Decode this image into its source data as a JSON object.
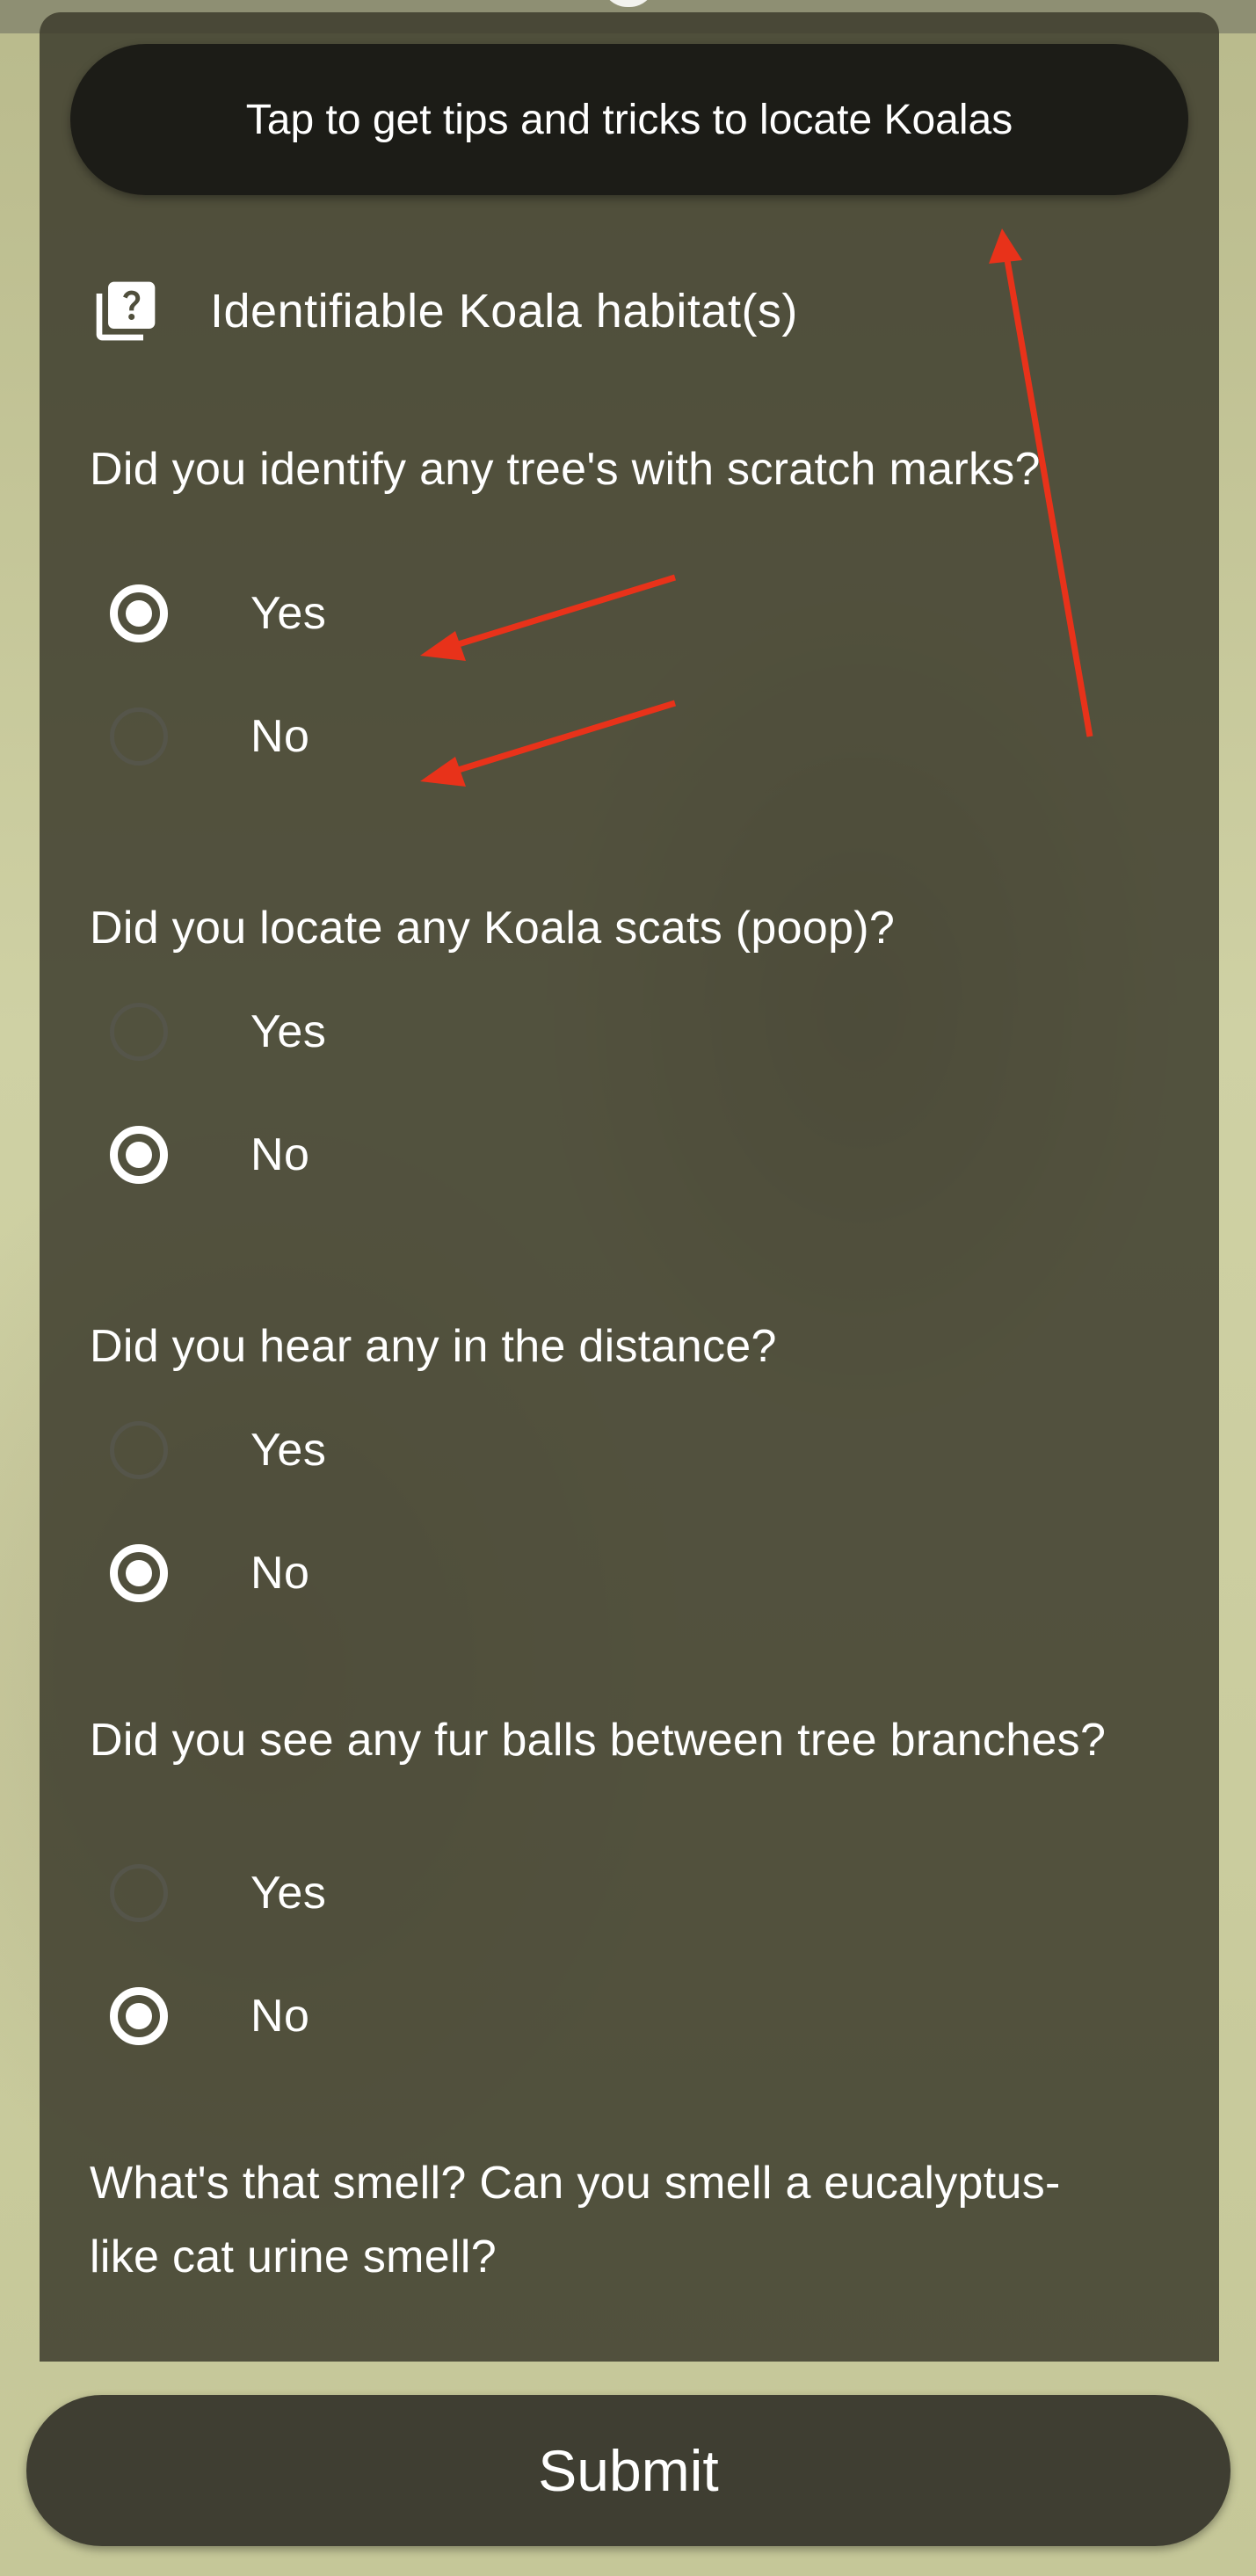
{
  "tips_button_label": "Tap to get tips and tricks to locate Koalas",
  "section": {
    "title": "Identifiable Koala habitat(s)",
    "icon": "help-book-icon"
  },
  "questions": [
    {
      "text": "Did you identify any tree's with scratch marks?",
      "options": [
        {
          "label": "Yes",
          "selected": true
        },
        {
          "label": "No",
          "selected": false
        }
      ]
    },
    {
      "text": "Did you locate any Koala scats (poop)?",
      "options": [
        {
          "label": "Yes",
          "selected": false
        },
        {
          "label": "No",
          "selected": true
        }
      ]
    },
    {
      "text": "Did you hear any in the distance?",
      "options": [
        {
          "label": "Yes",
          "selected": false
        },
        {
          "label": "No",
          "selected": true
        }
      ]
    },
    {
      "text": "Did you see any fur balls between tree branches?",
      "options": [
        {
          "label": "Yes",
          "selected": false
        },
        {
          "label": "No",
          "selected": true
        }
      ]
    },
    {
      "text": "What's that smell? Can you smell a eucalyptus-like cat urine smell?"
    }
  ],
  "submit_label": "Submit",
  "colors": {
    "panel": "#3e3d2d",
    "button": "#1c1c17",
    "annotation_arrow": "#e8321a"
  }
}
